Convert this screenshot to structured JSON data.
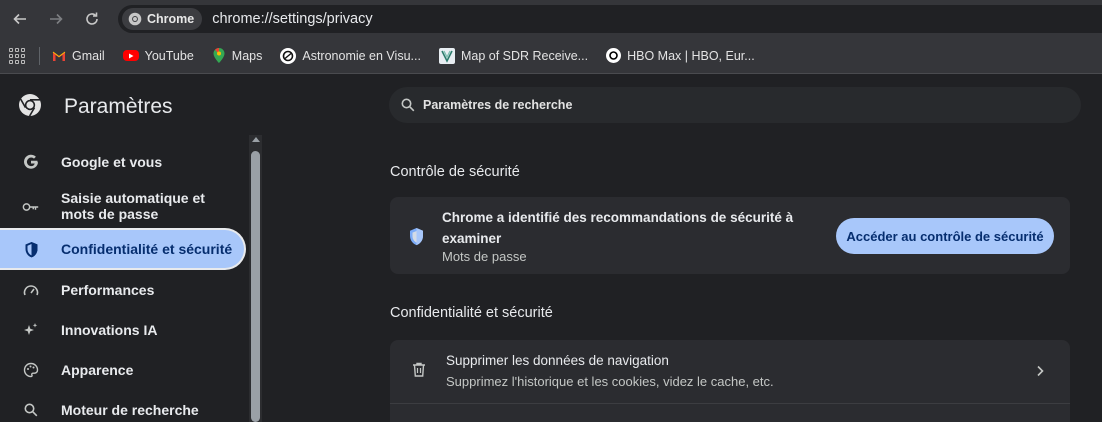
{
  "browser": {
    "omnibox_chip": "Chrome",
    "url": "chrome://settings/privacy"
  },
  "bookmarks": [
    {
      "label": "Gmail",
      "icon": "gmail-icon"
    },
    {
      "label": "YouTube",
      "icon": "youtube-icon"
    },
    {
      "label": "Maps",
      "icon": "maps-icon"
    },
    {
      "label": "Astronomie en Visu...",
      "icon": "astronomie-icon"
    },
    {
      "label": "Map of SDR Receive...",
      "icon": "sdr-map-icon"
    },
    {
      "label": "HBO Max | HBO, Eur...",
      "icon": "hbo-icon"
    }
  ],
  "sidebar": {
    "title": "Paramètres",
    "items": [
      {
        "label": "Google et vous",
        "icon": "google-g-icon"
      },
      {
        "label": "Saisie automatique et mots de passe",
        "icon": "key-icon"
      },
      {
        "label": "Confidentialité et sécurité",
        "icon": "shield-icon",
        "active": true
      },
      {
        "label": "Performances",
        "icon": "speedometer-icon"
      },
      {
        "label": "Innovations IA",
        "icon": "sparkle-icon"
      },
      {
        "label": "Apparence",
        "icon": "palette-icon"
      },
      {
        "label": "Moteur de recherche",
        "icon": "search-icon"
      }
    ]
  },
  "search": {
    "placeholder": "Paramètres de recherche"
  },
  "safety_check": {
    "section_title": "Contrôle de sécurité",
    "title": "Chrome a identifié des recommandations de sécurité à examiner",
    "subtitle": "Mots de passe",
    "button": "Accéder au contrôle de sécurité"
  },
  "privacy": {
    "section_title": "Confidentialité et sécurité",
    "rows": [
      {
        "title": "Supprimer les données de navigation",
        "subtitle": "Supprimez l'historique et les cookies, videz le cache, etc."
      }
    ]
  },
  "colors": {
    "accent": "#a8c7fa",
    "accent_text": "#062e6f",
    "background": "#202124",
    "card": "#2b2c30"
  }
}
